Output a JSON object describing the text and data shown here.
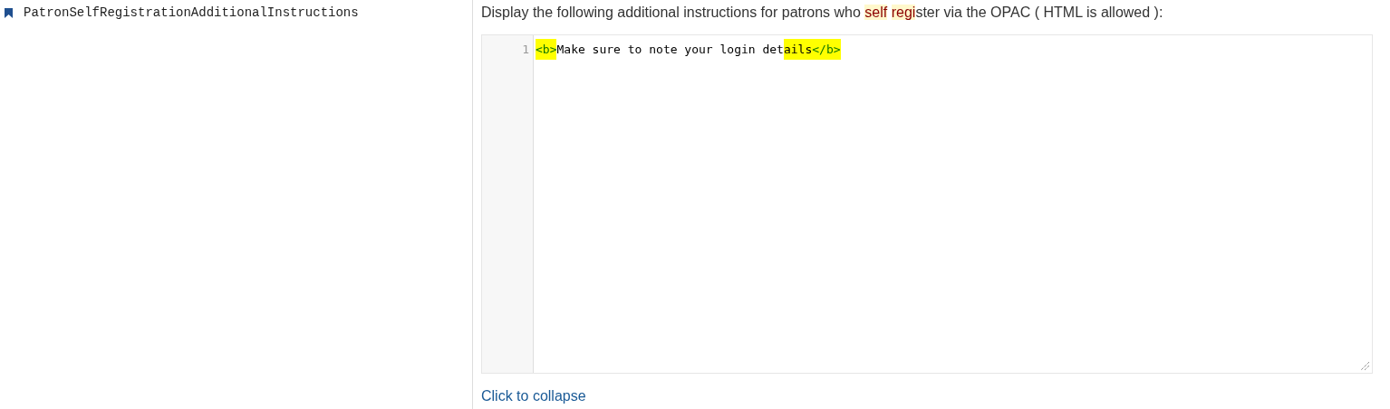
{
  "preference": {
    "name": "PatronSelfRegistrationAdditionalInstructions"
  },
  "description": [
    {
      "text": "Display the following additional instructions for patrons who ",
      "highlighted": false
    },
    {
      "text": "self",
      "highlighted": true
    },
    {
      "text": "regi",
      "highlighted": true,
      "space_before": true
    },
    {
      "text": "ster via the OPAC ( HTML is allowed ):",
      "highlighted": false
    }
  ],
  "editor": {
    "lines": [
      {
        "number": "1",
        "tokens": [
          {
            "text": "<b>",
            "kind": "tag",
            "highlighted": true
          },
          {
            "text": "Make sure to note your login det",
            "kind": "text",
            "highlighted": false
          },
          {
            "text": "ails",
            "kind": "text",
            "highlighted": true
          },
          {
            "text": "</b>",
            "kind": "tag",
            "highlighted": true
          }
        ]
      }
    ]
  },
  "collapse_link": "Click to collapse"
}
